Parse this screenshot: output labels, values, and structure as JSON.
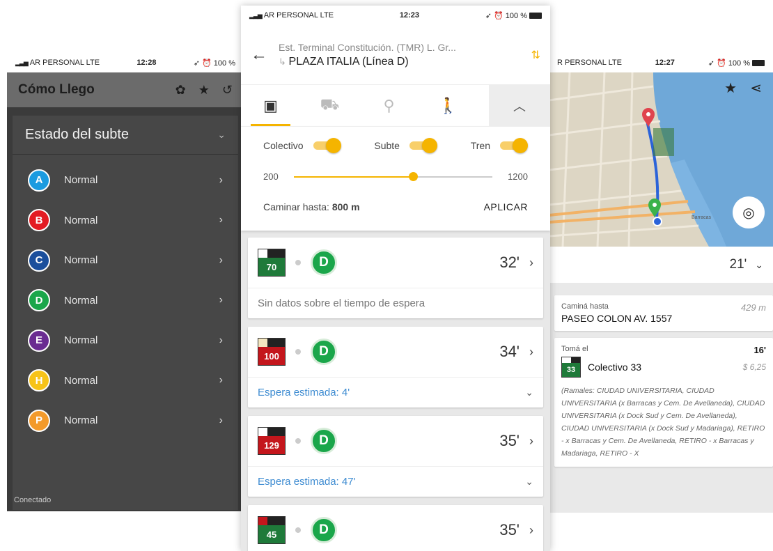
{
  "left": {
    "status": {
      "carrier": "AR PERSONAL",
      "network": "LTE",
      "time": "12:28",
      "battery": "100 %"
    },
    "app_title": "Cómo Llego",
    "section_title": "Estado del subte",
    "lines": [
      {
        "letter": "A",
        "color": "#1b9be0",
        "status": "Normal"
      },
      {
        "letter": "B",
        "color": "#e31b23",
        "status": "Normal"
      },
      {
        "letter": "C",
        "color": "#1b4f9c",
        "status": "Normal"
      },
      {
        "letter": "D",
        "color": "#1aa64a",
        "status": "Normal"
      },
      {
        "letter": "E",
        "color": "#6a2c91",
        "status": "Normal"
      },
      {
        "letter": "H",
        "color": "#f7c318",
        "status": "Normal"
      },
      {
        "letter": "P",
        "color": "#f39a2b",
        "status": "Normal"
      }
    ],
    "footer": "Conectado"
  },
  "center": {
    "status": {
      "carrier": "AR PERSONAL",
      "network": "LTE",
      "time": "12:23",
      "battery": "100 %"
    },
    "from": "Est. Terminal Constitución. (TMR) L. Gr...",
    "to": "PLAZA ITALIA (Línea D)",
    "filters": {
      "colectivo": "Colectivo",
      "subte": "Subte",
      "tren": "Tren",
      "min": "200",
      "max": "1200",
      "walk_label": "Caminar hasta:",
      "walk_value": "800 m",
      "apply": "APLICAR"
    },
    "results": [
      {
        "bus": "70",
        "bus_color": "#1f7a3a",
        "top": [
          "#ffffff",
          "#222222",
          "#222222"
        ],
        "line": "D",
        "time": "32'",
        "sub": "Sin datos sobre el tiempo de espera",
        "sub_style": "gray"
      },
      {
        "bus": "100",
        "bus_color": "#c4161c",
        "top": [
          "#f3e6c0",
          "#222222",
          "#222222"
        ],
        "line": "D",
        "time": "34'",
        "sub": "Espera estimada: 4'",
        "sub_style": "blue"
      },
      {
        "bus": "129",
        "bus_color": "#c4161c",
        "top": [
          "#ffffff",
          "#222222",
          "#222222"
        ],
        "line": "D",
        "time": "35'",
        "sub": "Espera estimada: 47'",
        "sub_style": "blue"
      },
      {
        "bus": "45",
        "bus_color": "#1f7a3a",
        "top": [
          "#c4161c",
          "#222222",
          "#222222"
        ],
        "line": "D",
        "time": "35'",
        "sub": "",
        "sub_style": "none"
      }
    ]
  },
  "right": {
    "status": {
      "carrier": "R PERSONAL",
      "network": "LTE",
      "time": "12:27",
      "battery": "100 %"
    },
    "summary_time": "21'",
    "walk": {
      "label": "Caminá hasta",
      "dest": "PASEO COLON AV. 1557",
      "dist": "429 m"
    },
    "take": {
      "label": "Tomá el",
      "bus": "33",
      "name": "Colectivo 33",
      "time": "16'",
      "fare": "$ 6,25",
      "ramales": "(Ramales: CIUDAD UNIVERSITARIA, CIUDAD UNIVERSITARIA (x Barracas y Cem. De Avellaneda), CIUDAD UNIVERSITARIA (x Dock Sud y Cem. De Avellaneda), CIUDAD UNIVERSITARIA (x Dock Sud y Madariaga), RETIRO - x Barracas y Cem. De Avellaneda, RETIRO - x Barracas y Madariaga, RETIRO - X"
    },
    "map_label": "Barracas"
  }
}
